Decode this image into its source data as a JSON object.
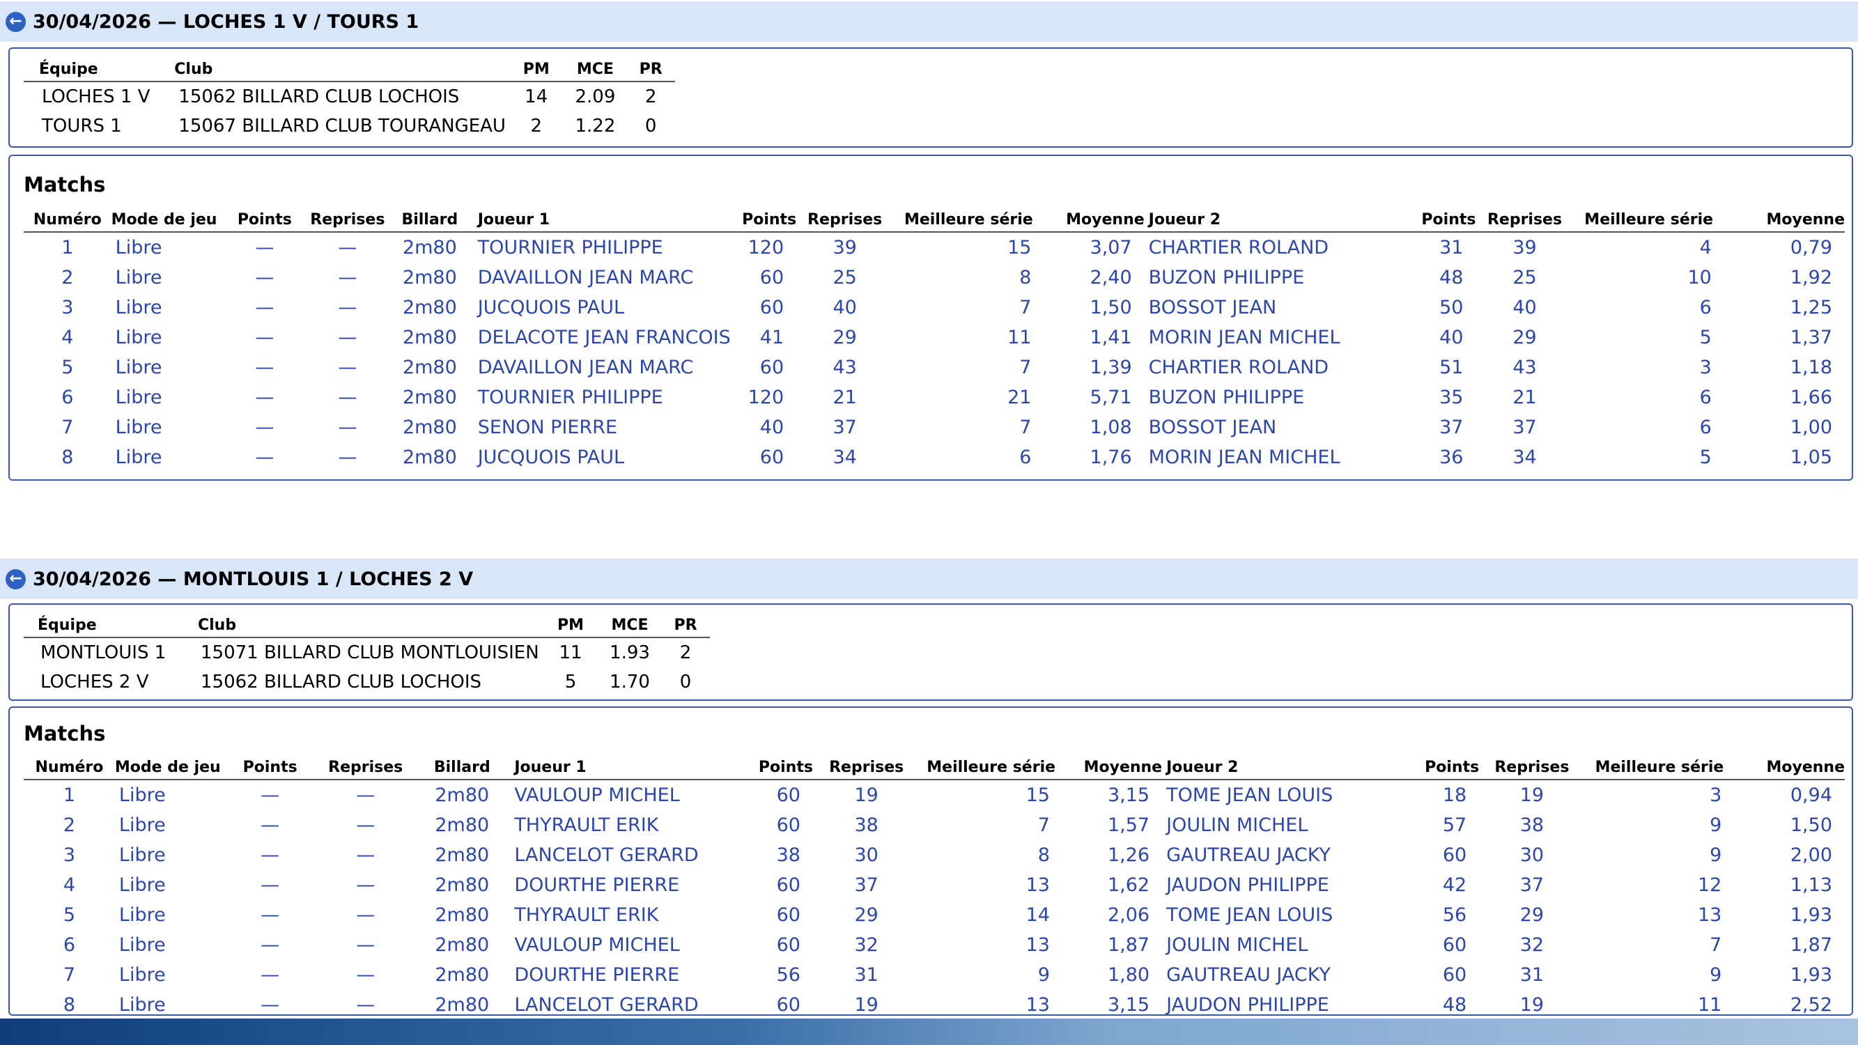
{
  "sections": [
    {
      "title": "30/04/2026 — LOCHES 1 V / TOURS 1",
      "teams_headers": {
        "equipe": "Équipe",
        "club": "Club",
        "pm": "PM",
        "mce": "MCE",
        "pr": "PR"
      },
      "teams": [
        {
          "equipe": "LOCHES 1 V",
          "club": "15062 BILLARD CLUB LOCHOIS",
          "pm": "14",
          "mce": "2.09",
          "pr": "2"
        },
        {
          "equipe": "TOURS 1",
          "club": "15067 BILLARD CLUB TOURANGEAU",
          "pm": "2",
          "mce": "1.22",
          "pr": "0"
        }
      ],
      "matchs_title": "Matchs",
      "match_headers": [
        "Numéro",
        "Mode de jeu",
        "Points",
        "Reprises",
        "Billard",
        "Joueur 1",
        "Points",
        "Reprises",
        "Meilleure série",
        "Moyenne",
        "Joueur 2",
        "Points",
        "Reprises",
        "Meilleure série",
        "Moyenne"
      ],
      "matches": [
        [
          "1",
          "Libre",
          "—",
          "—",
          "2m80",
          "TOURNIER PHILIPPE",
          "120",
          "39",
          "15",
          "3,07",
          "CHARTIER ROLAND",
          "31",
          "39",
          "4",
          "0,79"
        ],
        [
          "2",
          "Libre",
          "—",
          "—",
          "2m80",
          "DAVAILLON JEAN MARC",
          "60",
          "25",
          "8",
          "2,40",
          "BUZON PHILIPPE",
          "48",
          "25",
          "10",
          "1,92"
        ],
        [
          "3",
          "Libre",
          "—",
          "—",
          "2m80",
          "JUCQUOIS PAUL",
          "60",
          "40",
          "7",
          "1,50",
          "BOSSOT JEAN",
          "50",
          "40",
          "6",
          "1,25"
        ],
        [
          "4",
          "Libre",
          "—",
          "—",
          "2m80",
          "DELACOTE JEAN FRANCOIS",
          "41",
          "29",
          "11",
          "1,41",
          "MORIN JEAN MICHEL",
          "40",
          "29",
          "5",
          "1,37"
        ],
        [
          "5",
          "Libre",
          "—",
          "—",
          "2m80",
          "DAVAILLON JEAN MARC",
          "60",
          "43",
          "7",
          "1,39",
          "CHARTIER ROLAND",
          "51",
          "43",
          "3",
          "1,18"
        ],
        [
          "6",
          "Libre",
          "—",
          "—",
          "2m80",
          "TOURNIER PHILIPPE",
          "120",
          "21",
          "21",
          "5,71",
          "BUZON PHILIPPE",
          "35",
          "21",
          "6",
          "1,66"
        ],
        [
          "7",
          "Libre",
          "—",
          "—",
          "2m80",
          "SENON PIERRE",
          "40",
          "37",
          "7",
          "1,08",
          "BOSSOT JEAN",
          "37",
          "37",
          "6",
          "1,00"
        ],
        [
          "8",
          "Libre",
          "—",
          "—",
          "2m80",
          "JUCQUOIS PAUL",
          "60",
          "34",
          "6",
          "1,76",
          "MORIN JEAN MICHEL",
          "36",
          "34",
          "5",
          "1,05"
        ]
      ]
    },
    {
      "title": "30/04/2026 — MONTLOUIS 1 / LOCHES 2 V",
      "teams_headers": {
        "equipe": "Équipe",
        "club": "Club",
        "pm": "PM",
        "mce": "MCE",
        "pr": "PR"
      },
      "teams": [
        {
          "equipe": "MONTLOUIS 1",
          "club": "15071 BILLARD CLUB MONTLOUISIEN",
          "pm": "11",
          "mce": "1.93",
          "pr": "2"
        },
        {
          "equipe": "LOCHES 2 V",
          "club": "15062 BILLARD CLUB LOCHOIS",
          "pm": "5",
          "mce": "1.70",
          "pr": "0"
        }
      ],
      "matchs_title": "Matchs",
      "match_headers": [
        "Numéro",
        "Mode de jeu",
        "Points",
        "Reprises",
        "Billard",
        "Joueur 1",
        "Points",
        "Reprises",
        "Meilleure série",
        "Moyenne",
        "Joueur 2",
        "Points",
        "Reprises",
        "Meilleure série",
        "Moyenne"
      ],
      "matches": [
        [
          "1",
          "Libre",
          "—",
          "—",
          "2m80",
          "VAULOUP MICHEL",
          "60",
          "19",
          "15",
          "3,15",
          "TOME JEAN LOUIS",
          "18",
          "19",
          "3",
          "0,94"
        ],
        [
          "2",
          "Libre",
          "—",
          "—",
          "2m80",
          "THYRAULT ERIK",
          "60",
          "38",
          "7",
          "1,57",
          "JOULIN MICHEL",
          "57",
          "38",
          "9",
          "1,50"
        ],
        [
          "3",
          "Libre",
          "—",
          "—",
          "2m80",
          "LANCELOT GERARD",
          "38",
          "30",
          "8",
          "1,26",
          "GAUTREAU JACKY",
          "60",
          "30",
          "9",
          "2,00"
        ],
        [
          "4",
          "Libre",
          "—",
          "—",
          "2m80",
          "DOURTHE PIERRE",
          "60",
          "37",
          "13",
          "1,62",
          "JAUDON PHILIPPE",
          "42",
          "37",
          "12",
          "1,13"
        ],
        [
          "5",
          "Libre",
          "—",
          "—",
          "2m80",
          "THYRAULT ERIK",
          "60",
          "29",
          "14",
          "2,06",
          "TOME JEAN LOUIS",
          "56",
          "29",
          "13",
          "1,93"
        ],
        [
          "6",
          "Libre",
          "—",
          "—",
          "2m80",
          "VAULOUP MICHEL",
          "60",
          "32",
          "13",
          "1,87",
          "JOULIN MICHEL",
          "60",
          "32",
          "7",
          "1,87"
        ],
        [
          "7",
          "Libre",
          "—",
          "—",
          "2m80",
          "DOURTHE PIERRE",
          "56",
          "31",
          "9",
          "1,80",
          "GAUTREAU JACKY",
          "60",
          "31",
          "9",
          "1,93"
        ],
        [
          "8",
          "Libre",
          "—",
          "—",
          "2m80",
          "LANCELOT GERARD",
          "60",
          "19",
          "13",
          "3,15",
          "JAUDON PHILIPPE",
          "48",
          "19",
          "11",
          "2,52"
        ]
      ]
    }
  ]
}
